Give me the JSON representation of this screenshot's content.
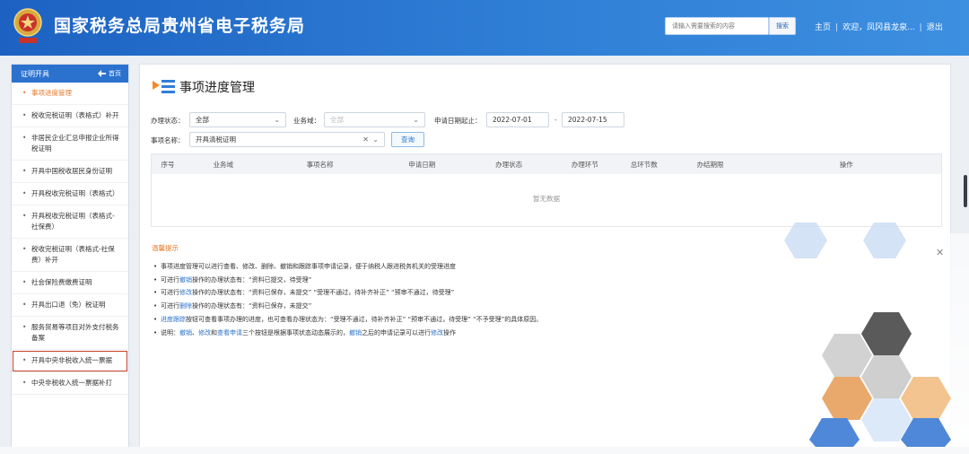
{
  "header": {
    "title": "国家税务总局贵州省电子税务局",
    "search_placeholder": "请输入需要搜索的内容",
    "search_button": "搜索",
    "links": [
      "主页",
      "欢迎，凤冈县龙泉...",
      "退出"
    ]
  },
  "sidebar": {
    "title": "证明开具",
    "back_label": "首页",
    "items": [
      {
        "label": "事项进度管理",
        "active": true
      },
      {
        "label": "税收完税证明（表格式）补开"
      },
      {
        "label": "非居民企业汇总申报企业所得税证明"
      },
      {
        "label": "开具中国税收居民身份证明"
      },
      {
        "label": "开具税收完税证明（表格式）"
      },
      {
        "label": "开具税收完税证明（表格式-社保费）"
      },
      {
        "label": "税收完税证明（表格式-社保费）补开"
      },
      {
        "label": "社会保险费缴费证明"
      },
      {
        "label": "开具出口退（免）税证明"
      },
      {
        "label": "服务贸易等项目对外支付税务备案"
      },
      {
        "label": "开具中央非税收入统一票据",
        "boxed": true
      },
      {
        "label": "中央非税收入统一票据补打"
      }
    ]
  },
  "main": {
    "title": "事项进度管理",
    "filters": {
      "status_label": "办理状态：",
      "status_value": "全部",
      "domain_label": "业务域：",
      "domain_value": "全部",
      "date_label": "申请日期起止：",
      "date_start": "2022-07-01",
      "date_sep": "-",
      "date_end": "2022-07-15",
      "item_label": "事项名称：",
      "item_value": "开具清税证明",
      "query_button": "查询"
    },
    "table": {
      "columns": [
        "序号",
        "业务域",
        "事项名称",
        "申请日期",
        "办理状态",
        "办理环节",
        "总环节数",
        "办结期限",
        "操作"
      ],
      "empty_text": "暂无数据"
    },
    "tips_title": "温馨提示",
    "tips": [
      {
        "segments": [
          {
            "t": "事项进度管理可以进行查看、修改、删除、撤销和跟踪事项申请记录，便于纳税人跟进税务机关的受理进度"
          }
        ]
      },
      {
        "segments": [
          {
            "t": "可进行"
          },
          {
            "t": "撤销",
            "link": true
          },
          {
            "t": "操作的办理状态有：“资料已提交，待受理”"
          }
        ]
      },
      {
        "segments": [
          {
            "t": "可进行"
          },
          {
            "t": "修改",
            "link": true
          },
          {
            "t": "操作的办理状态有：“资料已保存，未提交”  “受理不通过，待补齐补正”  “预审不通过，待受理”"
          }
        ]
      },
      {
        "segments": [
          {
            "t": "可进行"
          },
          {
            "t": "删除",
            "link": true
          },
          {
            "t": "操作的办理状态有：“资料已保存，未提交”"
          }
        ]
      },
      {
        "segments": [
          {
            "t": "进度跟踪",
            "link": true
          },
          {
            "t": "按钮可查看事项办理的进度，也可查看办理状态为：“受理不通过，待补齐补正”  “预审不通过，待受理”  “不予受理”的具体原因。"
          }
        ]
      },
      {
        "segments": [
          {
            "t": "说明："
          },
          {
            "t": "撤销",
            "link": true
          },
          {
            "t": "、"
          },
          {
            "t": "修改",
            "link": true
          },
          {
            "t": "和"
          },
          {
            "t": "查看申请",
            "link": true
          },
          {
            "t": "三个按钮是根据事项状态动态展示的，"
          },
          {
            "t": "撤销",
            "link": true
          },
          {
            "t": "之后的申请记录可以进行"
          },
          {
            "t": "修改",
            "link": true
          },
          {
            "t": "操作"
          }
        ]
      }
    ]
  },
  "colors": {
    "header_blue": "#2a72cf",
    "accent_orange": "#e8782a",
    "link_blue": "#2d73c8",
    "highlight_red": "#c8412c"
  }
}
